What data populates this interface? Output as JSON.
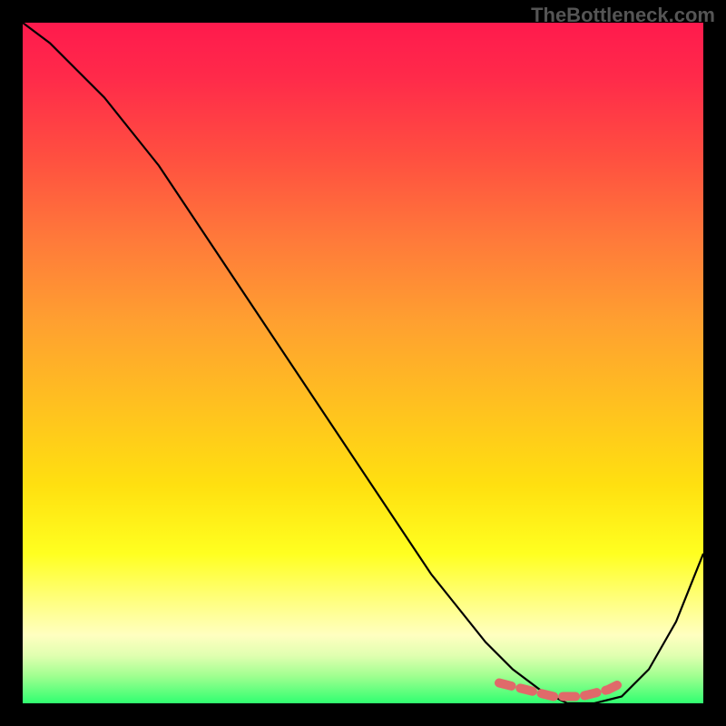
{
  "watermark": "TheBottleneck.com",
  "chart_data": {
    "type": "line",
    "title": "",
    "xlabel": "",
    "ylabel": "",
    "xlim": [
      0,
      100
    ],
    "ylim": [
      0,
      100
    ],
    "series": [
      {
        "name": "bottleneck-curve",
        "x": [
          0,
          4,
          8,
          12,
          16,
          20,
          24,
          28,
          32,
          36,
          40,
          44,
          48,
          52,
          56,
          60,
          64,
          68,
          72,
          76,
          80,
          84,
          88,
          92,
          96,
          100
        ],
        "values": [
          100,
          97,
          93,
          89,
          84,
          79,
          73,
          67,
          61,
          55,
          49,
          43,
          37,
          31,
          25,
          19,
          14,
          9,
          5,
          2,
          0,
          0,
          1,
          5,
          12,
          22
        ]
      },
      {
        "name": "highlight-band",
        "x": [
          70,
          72,
          74,
          76,
          78,
          80,
          82,
          84,
          86,
          88
        ],
        "values": [
          3,
          2.5,
          2,
          1.5,
          1,
          1,
          1,
          1.5,
          2,
          3
        ]
      }
    ],
    "annotations": []
  }
}
